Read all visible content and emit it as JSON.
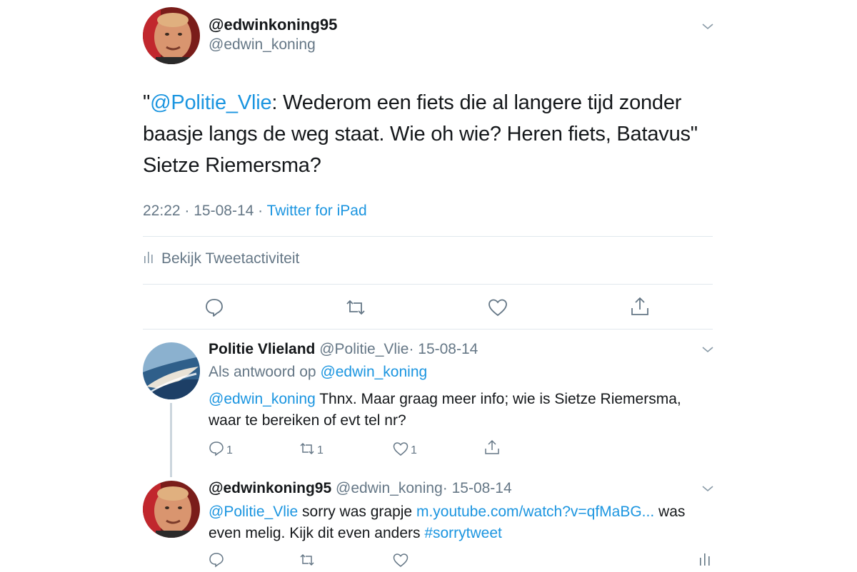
{
  "main_tweet": {
    "display_name": "@edwinkoning95",
    "handle": "@edwin_koning",
    "text_quote_open": "\"",
    "text_mention": "@Politie_Vlie",
    "text_rest": ": Wederom een fiets die al langere tijd zonder baasje langs de weg staat. Wie oh wie? Heren fiets, Batavus\" Sietze Riemersma?",
    "time": "22:22",
    "sep1": " · ",
    "date": "15-08-14",
    "sep2": " · ",
    "source": "Twitter for iPad",
    "activity_label": "Bekijk Tweetactiviteit"
  },
  "replies": [
    {
      "display_name": "Politie Vlieland",
      "handle": "@Politie_Vlie",
      "date": "· 15-08-14",
      "reply_to_prefix": "Als antwoord op ",
      "reply_to_handle": "@edwin_koning",
      "mention": "@edwin_koning",
      "text": " Thnx. Maar graag meer info; wie is Sietze Riemersma, waar te bereiken of evt tel nr?",
      "reply_count": "1",
      "retweet_count": "1",
      "like_count": "1"
    },
    {
      "display_name": "@edwinkoning95",
      "handle": "@edwin_koning",
      "date": "· 15-08-14",
      "mention": "@Politie_Vlie",
      "text_a": " sorry was grapje ",
      "link": "m.youtube.com/watch?v=qfMaBG...",
      "text_b": " was even melig. Kijk dit even anders ",
      "hashtag": "#sorrytweet"
    }
  ],
  "colors": {
    "accent": "#1b95e0",
    "muted": "#657786",
    "divider": "#e1e8ed"
  }
}
